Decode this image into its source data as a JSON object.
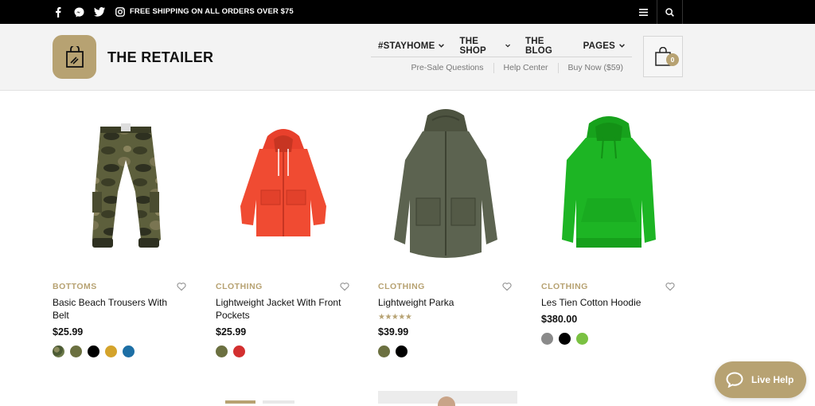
{
  "topbar": {
    "social_icons": [
      "facebook-icon",
      "messenger-icon",
      "twitter-icon",
      "instagram-icon"
    ],
    "shipping_text": "FREE SHIPPING ON ALL ORDERS OVER $75"
  },
  "header": {
    "brand": "THE RETAILER",
    "nav": [
      {
        "label": "#STAYHOME",
        "dropdown": true
      },
      {
        "label": "THE SHOP",
        "dropdown": true
      },
      {
        "label": "THE BLOG",
        "dropdown": false
      },
      {
        "label": "PAGES",
        "dropdown": true
      }
    ],
    "subnav": [
      "Pre-Sale Questions",
      "Help Center",
      "Buy Now ($59)"
    ],
    "cart_count": "0"
  },
  "colors": {
    "accent": "#b7a272",
    "topbar": "#000000"
  },
  "products": [
    {
      "category": "BOTTOMS",
      "name": "Basic Beach Trousers With Belt",
      "price": "$25.99",
      "rating_stars": 0,
      "swatches": [
        "camo",
        "#6b7040",
        "#000000",
        "#d4a32b",
        "#1d6fa5"
      ]
    },
    {
      "category": "CLOTHING",
      "name": "Lightweight Jacket With Front Pockets",
      "price": "$25.99",
      "rating_stars": 0,
      "swatches": [
        "#6b7040",
        "#d32f2f"
      ]
    },
    {
      "category": "CLOTHING",
      "name": "Lightweight Parka",
      "price": "$39.99",
      "rating_stars": 5,
      "swatches": [
        "#6b7040",
        "#000000"
      ]
    },
    {
      "category": "CLOTHING",
      "name": "Les Tien Cotton Hoodie",
      "price": "$380.00",
      "rating_stars": 0,
      "swatches": [
        "#8a8a8a",
        "#000000",
        "#7ac142"
      ]
    }
  ],
  "live_help": {
    "label": "Live Help"
  }
}
